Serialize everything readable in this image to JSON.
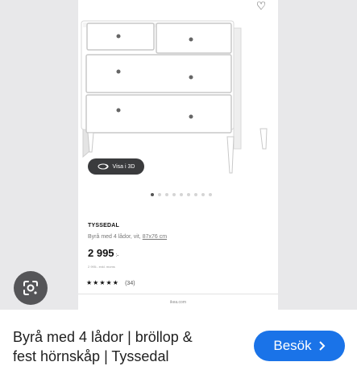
{
  "product": {
    "name": "TYSSEDAL",
    "description": "Byrå med 4 lådor, vit,",
    "dimensions": "87x76 cm",
    "price": "2 995",
    "currency": ":-",
    "small_text": "2 995:- exkl. moms",
    "rating_stars": "★★★★★",
    "rating_count": "(34)",
    "view_3d_label": "Visa i 3D",
    "domain": "ikea.com",
    "carousel_total": 9,
    "carousel_active": 0
  },
  "result": {
    "title_line1": "Byrå med 4 lådor | bröllop &",
    "title_line2": "fest hörnskåp | Tyssedal"
  },
  "visit_button": {
    "label": "Besök"
  },
  "icons": {
    "favorite": "heart-icon",
    "lens": "google-lens-icon",
    "view3d": "3d-view-icon",
    "visit": "chevron-right-icon"
  }
}
